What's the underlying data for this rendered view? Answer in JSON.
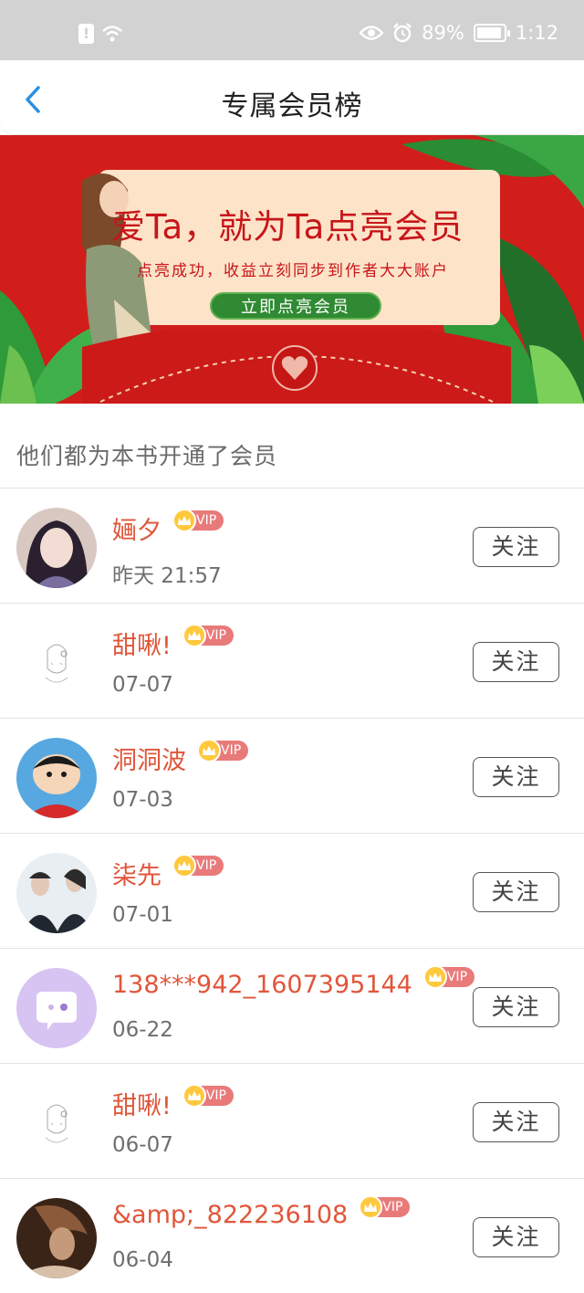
{
  "status_bar": {
    "battery": "89%",
    "time": "1:12",
    "icons": [
      "alert-icon",
      "wifi-icon",
      "eye-icon",
      "alarm-icon",
      "battery-icon"
    ]
  },
  "nav": {
    "title": "专属会员榜",
    "back_icon": "chevron-left-icon"
  },
  "banner": {
    "headline": "爱Ta，就为Ta点亮会员",
    "subtitle": "点亮成功，收益立刻同步到作者大大账户",
    "button_label": "立即点亮会员",
    "colors": {
      "background": "#d11e1a",
      "card": "#fde3c8",
      "button": "#2f8a33"
    }
  },
  "section_title": "他们都为本书开通了会员",
  "members": [
    {
      "name": "婳夕",
      "date": "昨天 21:57",
      "badge": "VIP",
      "avatar": "photo-girl",
      "follow_label": "关注"
    },
    {
      "name": "甜啾!",
      "date": "07-07",
      "badge": "VIP",
      "avatar": "sketch-girl",
      "follow_label": "关注"
    },
    {
      "name": "洞洞波",
      "date": "07-03",
      "badge": "VIP",
      "avatar": "cartoon-boy",
      "follow_label": "关注"
    },
    {
      "name": "柒先",
      "date": "07-01",
      "badge": "VIP",
      "avatar": "photo-couple",
      "follow_label": "关注"
    },
    {
      "name": "138***942_1607395144",
      "date": "06-22",
      "badge": "VIP",
      "avatar": "default-chat",
      "follow_label": "关注"
    },
    {
      "name": "甜啾!",
      "date": "06-07",
      "badge": "VIP",
      "avatar": "sketch-girl",
      "follow_label": "关注"
    },
    {
      "name": "&amp;_822236108",
      "date": "06-04",
      "badge": "VIP",
      "avatar": "photo-dark",
      "follow_label": "关注"
    }
  ],
  "colors": {
    "name": "#e0563a",
    "vip_badge": "#e97a7a",
    "crown": "#ffc83d"
  }
}
